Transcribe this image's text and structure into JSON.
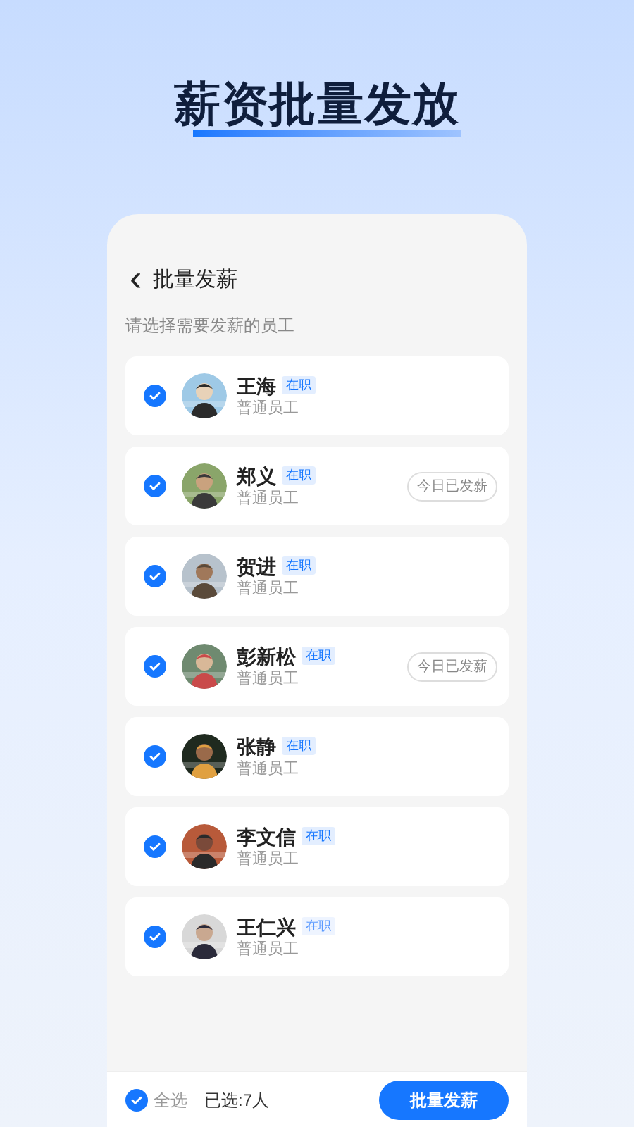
{
  "title": "薪资批量发放",
  "screen": {
    "back": "‹",
    "title": "批量发薪",
    "subtitle": "请选择需要发薪的员工"
  },
  "employees": [
    {
      "name": "王海",
      "status": "在职",
      "status_faded": false,
      "role": "普通员工",
      "checked": true,
      "kind": "picture"
    },
    {
      "name": "郑义",
      "status": "在职",
      "status_faded": false,
      "role": "普通员工",
      "checked": true,
      "tag": "今日已发薪",
      "kind": "picture"
    },
    {
      "name": "贺进",
      "status": "在职",
      "status_faded": false,
      "role": "普通员工",
      "checked": true,
      "kind": "picture"
    },
    {
      "name": "彭新松",
      "status": "在职",
      "status_faded": false,
      "role": "普通员工",
      "checked": true,
      "tag": "今日已发薪",
      "kind": "picture"
    },
    {
      "name": "张静",
      "status": "在职",
      "status_faded": false,
      "role": "普通员工",
      "checked": true,
      "kind": "picture"
    },
    {
      "name": "李文信",
      "status": "在职",
      "status_faded": false,
      "role": "普通员工",
      "checked": true,
      "kind": "picture"
    },
    {
      "name": "王仁兴",
      "status": "在职",
      "status_faded": true,
      "role": "普通员工",
      "checked": true,
      "kind": "picture"
    }
  ],
  "footer": {
    "select_all": {
      "label": "全选",
      "checked": true
    },
    "selected_count": "已选:7人",
    "button": "批量发薪"
  }
}
